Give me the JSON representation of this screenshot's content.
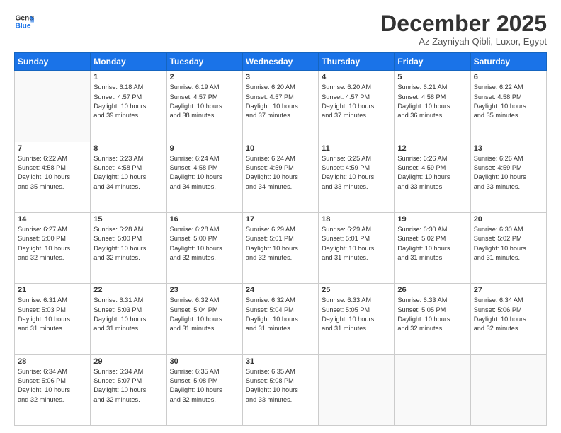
{
  "header": {
    "logo_line1": "General",
    "logo_line2": "Blue",
    "month_title": "December 2025",
    "location": "Az Zayniyah Qibli, Luxor, Egypt"
  },
  "days_of_week": [
    "Sunday",
    "Monday",
    "Tuesday",
    "Wednesday",
    "Thursday",
    "Friday",
    "Saturday"
  ],
  "weeks": [
    [
      {
        "day": "",
        "info": ""
      },
      {
        "day": "1",
        "info": "Sunrise: 6:18 AM\nSunset: 4:57 PM\nDaylight: 10 hours\nand 39 minutes."
      },
      {
        "day": "2",
        "info": "Sunrise: 6:19 AM\nSunset: 4:57 PM\nDaylight: 10 hours\nand 38 minutes."
      },
      {
        "day": "3",
        "info": "Sunrise: 6:20 AM\nSunset: 4:57 PM\nDaylight: 10 hours\nand 37 minutes."
      },
      {
        "day": "4",
        "info": "Sunrise: 6:20 AM\nSunset: 4:57 PM\nDaylight: 10 hours\nand 37 minutes."
      },
      {
        "day": "5",
        "info": "Sunrise: 6:21 AM\nSunset: 4:58 PM\nDaylight: 10 hours\nand 36 minutes."
      },
      {
        "day": "6",
        "info": "Sunrise: 6:22 AM\nSunset: 4:58 PM\nDaylight: 10 hours\nand 35 minutes."
      }
    ],
    [
      {
        "day": "7",
        "info": "Sunrise: 6:22 AM\nSunset: 4:58 PM\nDaylight: 10 hours\nand 35 minutes."
      },
      {
        "day": "8",
        "info": "Sunrise: 6:23 AM\nSunset: 4:58 PM\nDaylight: 10 hours\nand 34 minutes."
      },
      {
        "day": "9",
        "info": "Sunrise: 6:24 AM\nSunset: 4:58 PM\nDaylight: 10 hours\nand 34 minutes."
      },
      {
        "day": "10",
        "info": "Sunrise: 6:24 AM\nSunset: 4:59 PM\nDaylight: 10 hours\nand 34 minutes."
      },
      {
        "day": "11",
        "info": "Sunrise: 6:25 AM\nSunset: 4:59 PM\nDaylight: 10 hours\nand 33 minutes."
      },
      {
        "day": "12",
        "info": "Sunrise: 6:26 AM\nSunset: 4:59 PM\nDaylight: 10 hours\nand 33 minutes."
      },
      {
        "day": "13",
        "info": "Sunrise: 6:26 AM\nSunset: 4:59 PM\nDaylight: 10 hours\nand 33 minutes."
      }
    ],
    [
      {
        "day": "14",
        "info": "Sunrise: 6:27 AM\nSunset: 5:00 PM\nDaylight: 10 hours\nand 32 minutes."
      },
      {
        "day": "15",
        "info": "Sunrise: 6:28 AM\nSunset: 5:00 PM\nDaylight: 10 hours\nand 32 minutes."
      },
      {
        "day": "16",
        "info": "Sunrise: 6:28 AM\nSunset: 5:00 PM\nDaylight: 10 hours\nand 32 minutes."
      },
      {
        "day": "17",
        "info": "Sunrise: 6:29 AM\nSunset: 5:01 PM\nDaylight: 10 hours\nand 32 minutes."
      },
      {
        "day": "18",
        "info": "Sunrise: 6:29 AM\nSunset: 5:01 PM\nDaylight: 10 hours\nand 31 minutes."
      },
      {
        "day": "19",
        "info": "Sunrise: 6:30 AM\nSunset: 5:02 PM\nDaylight: 10 hours\nand 31 minutes."
      },
      {
        "day": "20",
        "info": "Sunrise: 6:30 AM\nSunset: 5:02 PM\nDaylight: 10 hours\nand 31 minutes."
      }
    ],
    [
      {
        "day": "21",
        "info": "Sunrise: 6:31 AM\nSunset: 5:03 PM\nDaylight: 10 hours\nand 31 minutes."
      },
      {
        "day": "22",
        "info": "Sunrise: 6:31 AM\nSunset: 5:03 PM\nDaylight: 10 hours\nand 31 minutes."
      },
      {
        "day": "23",
        "info": "Sunrise: 6:32 AM\nSunset: 5:04 PM\nDaylight: 10 hours\nand 31 minutes."
      },
      {
        "day": "24",
        "info": "Sunrise: 6:32 AM\nSunset: 5:04 PM\nDaylight: 10 hours\nand 31 minutes."
      },
      {
        "day": "25",
        "info": "Sunrise: 6:33 AM\nSunset: 5:05 PM\nDaylight: 10 hours\nand 31 minutes."
      },
      {
        "day": "26",
        "info": "Sunrise: 6:33 AM\nSunset: 5:05 PM\nDaylight: 10 hours\nand 32 minutes."
      },
      {
        "day": "27",
        "info": "Sunrise: 6:34 AM\nSunset: 5:06 PM\nDaylight: 10 hours\nand 32 minutes."
      }
    ],
    [
      {
        "day": "28",
        "info": "Sunrise: 6:34 AM\nSunset: 5:06 PM\nDaylight: 10 hours\nand 32 minutes."
      },
      {
        "day": "29",
        "info": "Sunrise: 6:34 AM\nSunset: 5:07 PM\nDaylight: 10 hours\nand 32 minutes."
      },
      {
        "day": "30",
        "info": "Sunrise: 6:35 AM\nSunset: 5:08 PM\nDaylight: 10 hours\nand 32 minutes."
      },
      {
        "day": "31",
        "info": "Sunrise: 6:35 AM\nSunset: 5:08 PM\nDaylight: 10 hours\nand 33 minutes."
      },
      {
        "day": "",
        "info": ""
      },
      {
        "day": "",
        "info": ""
      },
      {
        "day": "",
        "info": ""
      }
    ]
  ]
}
